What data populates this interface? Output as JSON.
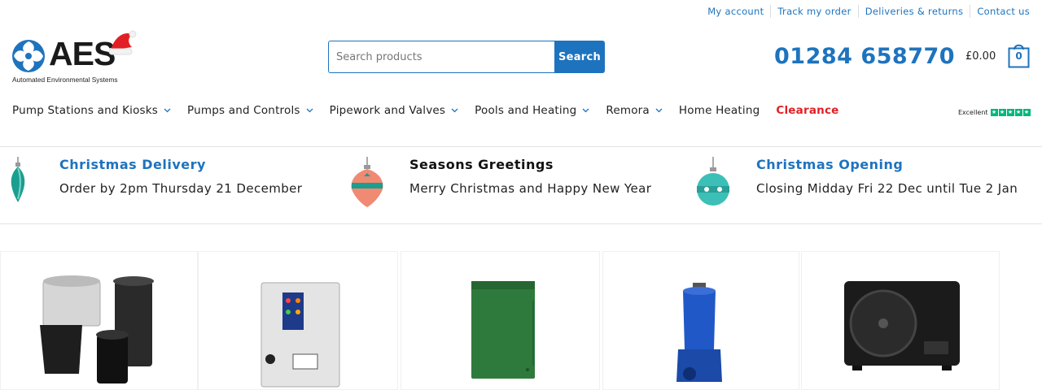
{
  "top_links": [
    "My account",
    "Track my order",
    "Deliveries & returns",
    "Contact us"
  ],
  "logo": {
    "name": "AES",
    "tagline": "Automated Environmental Systems"
  },
  "search": {
    "placeholder": "Search products",
    "button_label": "Search"
  },
  "phone": "01284 658770",
  "cart": {
    "total": "£0.00",
    "count": "0"
  },
  "nav": [
    {
      "label": "Pump Stations and Kiosks",
      "has_dropdown": true
    },
    {
      "label": "Pumps and Controls",
      "has_dropdown": true
    },
    {
      "label": "Pipework and Valves",
      "has_dropdown": true
    },
    {
      "label": "Pools and Heating",
      "has_dropdown": true
    },
    {
      "label": "Remora",
      "has_dropdown": true
    },
    {
      "label": "Home Heating",
      "has_dropdown": false
    },
    {
      "label": "Clearance",
      "has_dropdown": false
    }
  ],
  "trust": {
    "label": "Excellent",
    "rating_stars": 5
  },
  "notices": [
    {
      "title": "Christmas Delivery",
      "text": "Order by 2pm Thursday 21 December"
    },
    {
      "title": "Seasons Greetings",
      "text": "Merry Christmas and Happy New Year"
    },
    {
      "title": "Christmas Opening",
      "text": "Closing Midday Fri 22 Dec until Tue 2 Jan"
    }
  ],
  "products": [
    {
      "icon": "pump-chambers-icon"
    },
    {
      "icon": "control-panel-icon"
    },
    {
      "icon": "green-kiosk-icon"
    },
    {
      "icon": "submersible-pump-icon"
    },
    {
      "icon": "heat-pump-icon"
    }
  ],
  "colors": {
    "brand_blue": "#1e73be",
    "clearance_red": "#e21f26",
    "trustpilot_green": "#00b67a"
  }
}
